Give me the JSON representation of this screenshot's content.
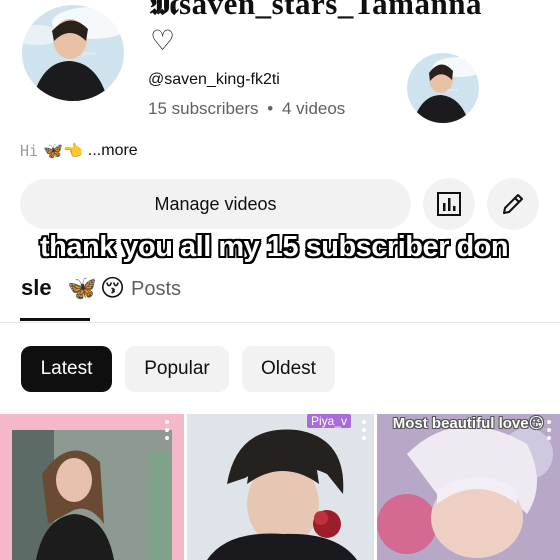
{
  "channel": {
    "title": "𝕸saven_stars_Tamanna",
    "heart": "♡",
    "handle": "@saven_king-fk2ti",
    "subscribers": "15 subscribers",
    "separator": "•",
    "videos": "4 videos",
    "description_hi": "Hi",
    "description_emojis": "🦋👈",
    "description_more": "...more"
  },
  "actions": {
    "manage_videos": "Manage videos",
    "analytics_icon": "analytics-bar-chart-icon",
    "edit_icon": "pencil-icon"
  },
  "overlay": {
    "caption": "thank you all my 15 subscriber  don",
    "tab_fragment": "sle",
    "emoji_butterfly": "🦋",
    "emoji_kiss": "😚"
  },
  "tabs": {
    "posts": "Posts"
  },
  "filters": {
    "latest": "Latest",
    "popular": "Popular",
    "oldest": "Oldest"
  },
  "thumbnails": [
    {
      "tag": "",
      "caption": ""
    },
    {
      "tag": "Piya_v",
      "caption": ""
    },
    {
      "tag": "",
      "caption": "Most beautiful love😘"
    }
  ],
  "colors": {
    "chip_active_bg": "#0f0f0f",
    "chip_bg": "#f2f2f2",
    "secondary_text": "#606060"
  }
}
